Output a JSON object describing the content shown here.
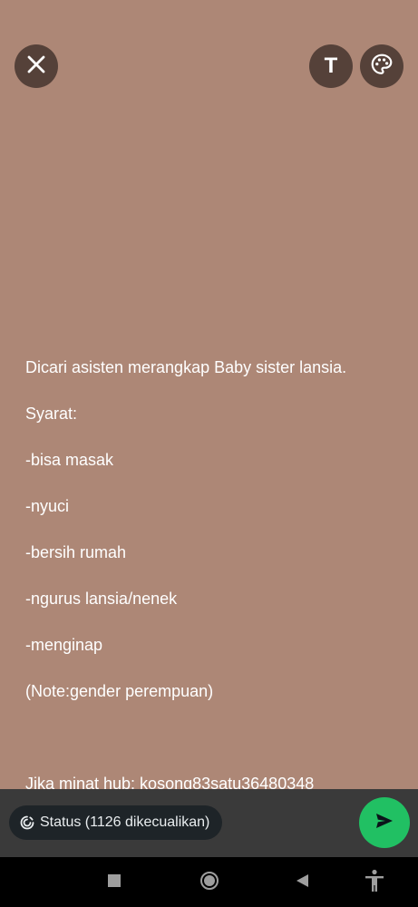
{
  "toolbar": {
    "close_icon": "close-icon",
    "text_icon": "text-format-icon",
    "text_glyph": "T",
    "palette_icon": "palette-icon"
  },
  "status": {
    "background_color": "#ad8776",
    "text_color": "#ffffff",
    "lines": [
      "Dicari asisten merangkap Baby sister lansia.",
      "Syarat:",
      "-bisa masak",
      "-nyuci",
      "-bersih rumah",
      "-ngurus lansia/nenek",
      "-menginap",
      "(Note:gender perempuan)",
      "",
      "Jika minat hub: kosong83satu36480348"
    ]
  },
  "bottom": {
    "audience_label": "Status (1126 dikecualikan)",
    "audience_icon": "status-ring-icon",
    "send_icon": "send-icon",
    "send_color": "#21c063"
  },
  "nav": {
    "recent_icon": "recent-apps-icon",
    "home_icon": "home-icon",
    "back_icon": "back-icon",
    "accessibility_icon": "accessibility-icon"
  }
}
